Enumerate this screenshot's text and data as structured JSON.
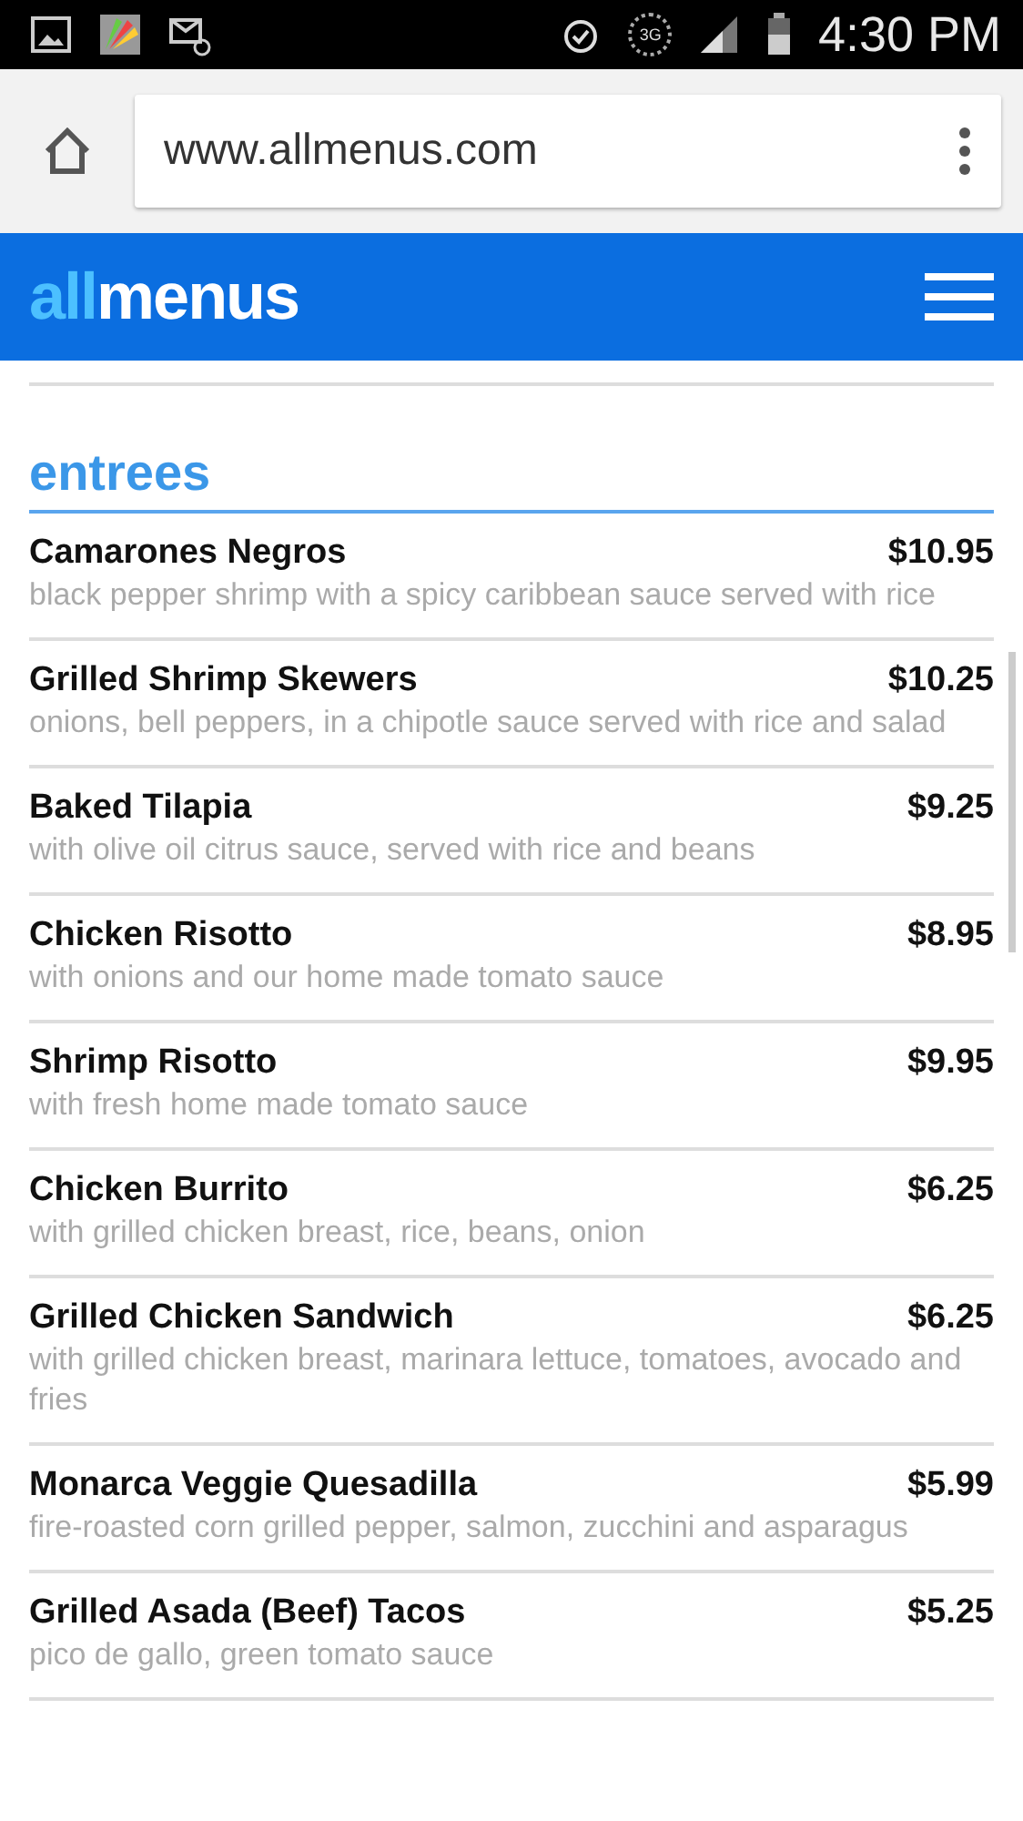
{
  "status_bar": {
    "network": "3G",
    "time": "4:30 PM"
  },
  "browser": {
    "url": "www.allmenus.com"
  },
  "header": {
    "logo": {
      "accent": "all",
      "main": "menus"
    }
  },
  "section": {
    "title": "entrees",
    "items": [
      {
        "name": "Camarones Negros",
        "price": "$10.95",
        "description": "black pepper shrimp with a spicy caribbean sauce served with rice"
      },
      {
        "name": "Grilled Shrimp Skewers",
        "price": "$10.25",
        "description": "onions, bell peppers, in a chipotle sauce served with rice and salad"
      },
      {
        "name": "Baked Tilapia",
        "price": "$9.25",
        "description": "with olive oil citrus sauce, served with rice and beans"
      },
      {
        "name": "Chicken Risotto",
        "price": "$8.95",
        "description": "with onions and our home made tomato sauce"
      },
      {
        "name": "Shrimp Risotto",
        "price": "$9.95",
        "description": "with fresh home made tomato sauce"
      },
      {
        "name": "Chicken Burrito",
        "price": "$6.25",
        "description": "with grilled chicken breast, rice, beans, onion"
      },
      {
        "name": "Grilled Chicken Sandwich",
        "price": "$6.25",
        "description": "with grilled chicken breast, marinara lettuce, tomatoes, avocado and fries"
      },
      {
        "name": "Monarca Veggie Quesadilla",
        "price": "$5.99",
        "description": "fire-roasted corn grilled pepper, salmon, zucchini and asparagus"
      },
      {
        "name": "Grilled Asada (Beef) Tacos",
        "price": "$5.25",
        "description": "pico de gallo, green tomato sauce"
      }
    ]
  }
}
